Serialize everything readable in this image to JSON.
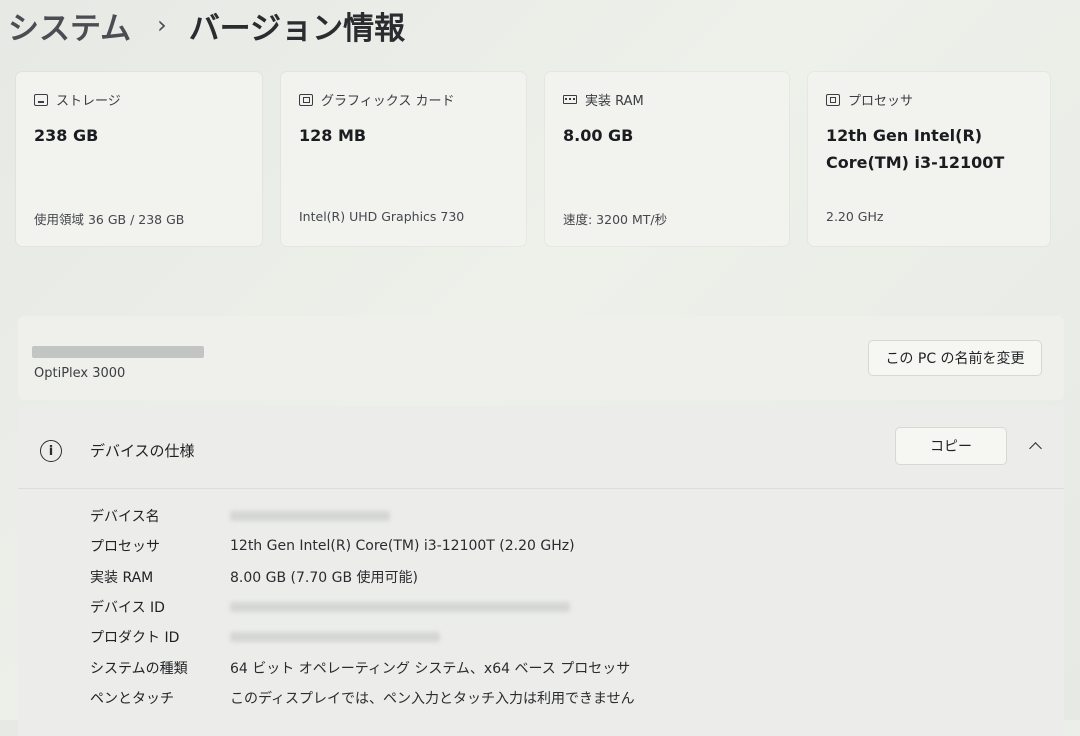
{
  "breadcrumb": {
    "parent": "システム",
    "separator": "›",
    "current": "バージョン情報"
  },
  "cards": [
    {
      "icon": "storage-icon",
      "label": "ストレージ",
      "value": "238 GB",
      "sub": "使用領域 36 GB / 238 GB"
    },
    {
      "icon": "gpu-icon",
      "label": "グラフィックス カード",
      "value": "128 MB",
      "sub": "Intel(R) UHD Graphics 730"
    },
    {
      "icon": "ram-icon",
      "label": "実装 RAM",
      "value": "8.00 GB",
      "sub": "速度: 3200 MT/秒"
    },
    {
      "icon": "processor-icon",
      "label": "プロセッサ",
      "value_line1": "12th Gen Intel(R)",
      "value_line2": "Core(TM) i3-12100T",
      "sub": "2.20 GHz"
    }
  ],
  "pc": {
    "model": "OptiPlex 3000",
    "rename_label": "この PC の名前を変更"
  },
  "specs": {
    "title": "デバイスの仕様",
    "copy_label": "コピー",
    "rows": [
      {
        "label": "デバイス名",
        "value": ""
      },
      {
        "label": "プロセッサ",
        "value": "12th Gen Intel(R) Core(TM) i3-12100T (2.20 GHz)"
      },
      {
        "label": "実装 RAM",
        "value": "8.00 GB (7.70 GB 使用可能)"
      },
      {
        "label": "デバイス ID",
        "value": ""
      },
      {
        "label": "プロダクト ID",
        "value": ""
      },
      {
        "label": "システムの種類",
        "value": "64 ビット オペレーティング システム、x64 ベース プロセッサ"
      },
      {
        "label": "ペンとタッチ",
        "value": "このディスプレイでは、ペン入力とタッチ入力は利用できません"
      }
    ]
  }
}
